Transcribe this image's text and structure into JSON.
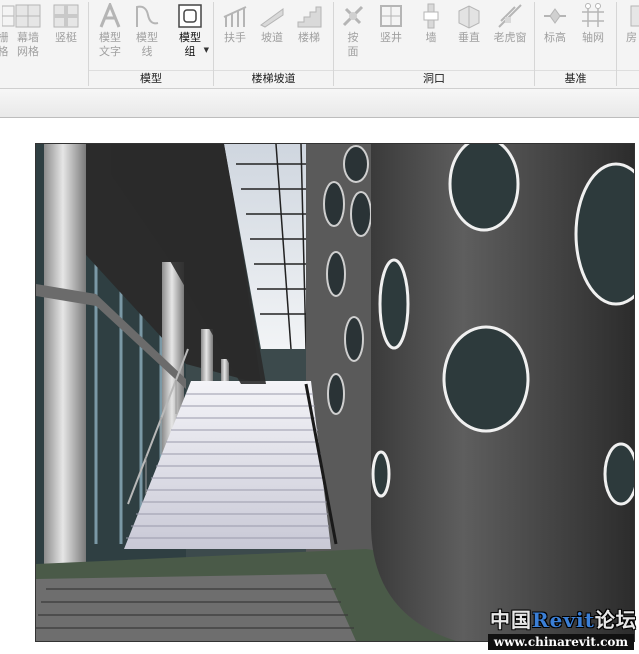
{
  "ribbon": {
    "buttons": {
      "curtain_partial": "栅",
      "curtain_partial2": "格",
      "curtain_grid": "幕墙\n网格",
      "mullion": "竖梃",
      "model_text": "模型\n文字",
      "model_line": "模型\n线",
      "model_group": "模型\n组",
      "railing": "扶手",
      "ramp": "坡道",
      "stair": "楼梯",
      "by_face": "按\n面",
      "shaft": "竖井",
      "wall": "墙",
      "vertical": "垂直",
      "dormer": "老虎窗",
      "level": "标高",
      "grid": "轴网",
      "room_partial": "房"
    },
    "panels": {
      "model": "模型",
      "circulation": "楼梯坡道",
      "opening": "洞口",
      "datum": "基准"
    }
  },
  "watermark": {
    "title_prefix": "中国",
    "title_accent": "Revit",
    "title_suffix": "论坛",
    "url": "www.chinarevit.com"
  },
  "colors": {
    "ribbon_bg": "#f4f4f4",
    "disabled_text": "#a0a0a0",
    "watermark_accent": "#3b7fd6"
  }
}
